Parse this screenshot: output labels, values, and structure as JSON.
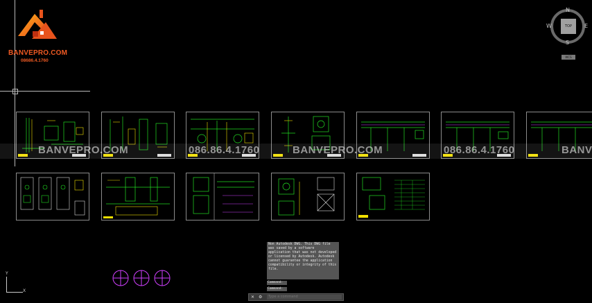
{
  "app": {
    "logo_name": "BANVEPRO.COM",
    "logo_phone": "08686.4.1760"
  },
  "watermarks": [
    "BANVEPRO.COM",
    "086.86.4.1760",
    "BANVEPRO.COM",
    "086.86.4.1760",
    "BANVE"
  ],
  "viewcube": {
    "north": "N",
    "south": "S",
    "east": "E",
    "west": "W",
    "face": "TOP",
    "wcs": "WCS"
  },
  "ucs": {
    "x": "X",
    "y": "Y"
  },
  "messages": {
    "warning": "Non Autodesk DWG.  This DWG file was saved by a software application that was not developed or licensed by Autodesk.  Autodesk cannot guarantee the application compatibility or integrity of this file.",
    "history": [
      "Command:",
      "Command:"
    ]
  },
  "command_bar": {
    "placeholder": "Type a command",
    "close_glyph": "✕",
    "wrench_glyph": "⚙"
  },
  "colors": {
    "background": "#000000",
    "sheet_border": "#8c8c8c",
    "green_lines": "#22dd22",
    "yellow_lines": "#f2e000",
    "magenta_lines": "#d040ff",
    "logo_orange": "#f05a23"
  }
}
